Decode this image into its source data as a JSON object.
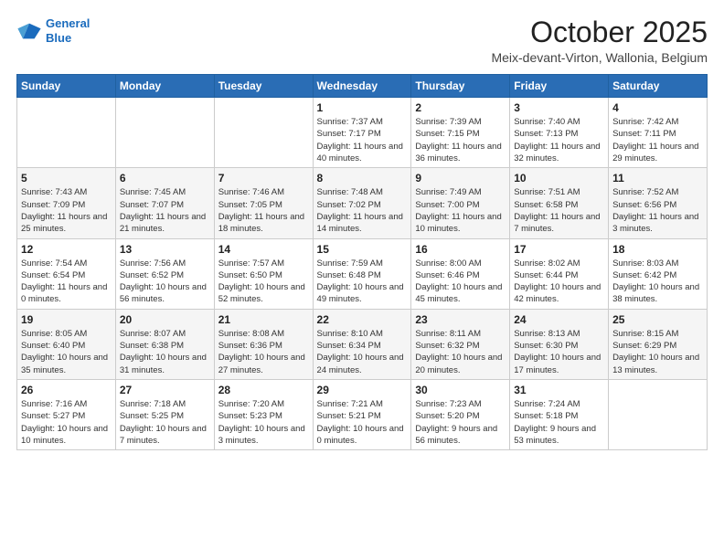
{
  "header": {
    "logo_line1": "General",
    "logo_line2": "Blue",
    "month": "October 2025",
    "location": "Meix-devant-Virton, Wallonia, Belgium"
  },
  "weekdays": [
    "Sunday",
    "Monday",
    "Tuesday",
    "Wednesday",
    "Thursday",
    "Friday",
    "Saturday"
  ],
  "weeks": [
    [
      {
        "day": "",
        "sunrise": "",
        "sunset": "",
        "daylight": ""
      },
      {
        "day": "",
        "sunrise": "",
        "sunset": "",
        "daylight": ""
      },
      {
        "day": "",
        "sunrise": "",
        "sunset": "",
        "daylight": ""
      },
      {
        "day": "1",
        "sunrise": "Sunrise: 7:37 AM",
        "sunset": "Sunset: 7:17 PM",
        "daylight": "Daylight: 11 hours and 40 minutes."
      },
      {
        "day": "2",
        "sunrise": "Sunrise: 7:39 AM",
        "sunset": "Sunset: 7:15 PM",
        "daylight": "Daylight: 11 hours and 36 minutes."
      },
      {
        "day": "3",
        "sunrise": "Sunrise: 7:40 AM",
        "sunset": "Sunset: 7:13 PM",
        "daylight": "Daylight: 11 hours and 32 minutes."
      },
      {
        "day": "4",
        "sunrise": "Sunrise: 7:42 AM",
        "sunset": "Sunset: 7:11 PM",
        "daylight": "Daylight: 11 hours and 29 minutes."
      }
    ],
    [
      {
        "day": "5",
        "sunrise": "Sunrise: 7:43 AM",
        "sunset": "Sunset: 7:09 PM",
        "daylight": "Daylight: 11 hours and 25 minutes."
      },
      {
        "day": "6",
        "sunrise": "Sunrise: 7:45 AM",
        "sunset": "Sunset: 7:07 PM",
        "daylight": "Daylight: 11 hours and 21 minutes."
      },
      {
        "day": "7",
        "sunrise": "Sunrise: 7:46 AM",
        "sunset": "Sunset: 7:05 PM",
        "daylight": "Daylight: 11 hours and 18 minutes."
      },
      {
        "day": "8",
        "sunrise": "Sunrise: 7:48 AM",
        "sunset": "Sunset: 7:02 PM",
        "daylight": "Daylight: 11 hours and 14 minutes."
      },
      {
        "day": "9",
        "sunrise": "Sunrise: 7:49 AM",
        "sunset": "Sunset: 7:00 PM",
        "daylight": "Daylight: 11 hours and 10 minutes."
      },
      {
        "day": "10",
        "sunrise": "Sunrise: 7:51 AM",
        "sunset": "Sunset: 6:58 PM",
        "daylight": "Daylight: 11 hours and 7 minutes."
      },
      {
        "day": "11",
        "sunrise": "Sunrise: 7:52 AM",
        "sunset": "Sunset: 6:56 PM",
        "daylight": "Daylight: 11 hours and 3 minutes."
      }
    ],
    [
      {
        "day": "12",
        "sunrise": "Sunrise: 7:54 AM",
        "sunset": "Sunset: 6:54 PM",
        "daylight": "Daylight: 11 hours and 0 minutes."
      },
      {
        "day": "13",
        "sunrise": "Sunrise: 7:56 AM",
        "sunset": "Sunset: 6:52 PM",
        "daylight": "Daylight: 10 hours and 56 minutes."
      },
      {
        "day": "14",
        "sunrise": "Sunrise: 7:57 AM",
        "sunset": "Sunset: 6:50 PM",
        "daylight": "Daylight: 10 hours and 52 minutes."
      },
      {
        "day": "15",
        "sunrise": "Sunrise: 7:59 AM",
        "sunset": "Sunset: 6:48 PM",
        "daylight": "Daylight: 10 hours and 49 minutes."
      },
      {
        "day": "16",
        "sunrise": "Sunrise: 8:00 AM",
        "sunset": "Sunset: 6:46 PM",
        "daylight": "Daylight: 10 hours and 45 minutes."
      },
      {
        "day": "17",
        "sunrise": "Sunrise: 8:02 AM",
        "sunset": "Sunset: 6:44 PM",
        "daylight": "Daylight: 10 hours and 42 minutes."
      },
      {
        "day": "18",
        "sunrise": "Sunrise: 8:03 AM",
        "sunset": "Sunset: 6:42 PM",
        "daylight": "Daylight: 10 hours and 38 minutes."
      }
    ],
    [
      {
        "day": "19",
        "sunrise": "Sunrise: 8:05 AM",
        "sunset": "Sunset: 6:40 PM",
        "daylight": "Daylight: 10 hours and 35 minutes."
      },
      {
        "day": "20",
        "sunrise": "Sunrise: 8:07 AM",
        "sunset": "Sunset: 6:38 PM",
        "daylight": "Daylight: 10 hours and 31 minutes."
      },
      {
        "day": "21",
        "sunrise": "Sunrise: 8:08 AM",
        "sunset": "Sunset: 6:36 PM",
        "daylight": "Daylight: 10 hours and 27 minutes."
      },
      {
        "day": "22",
        "sunrise": "Sunrise: 8:10 AM",
        "sunset": "Sunset: 6:34 PM",
        "daylight": "Daylight: 10 hours and 24 minutes."
      },
      {
        "day": "23",
        "sunrise": "Sunrise: 8:11 AM",
        "sunset": "Sunset: 6:32 PM",
        "daylight": "Daylight: 10 hours and 20 minutes."
      },
      {
        "day": "24",
        "sunrise": "Sunrise: 8:13 AM",
        "sunset": "Sunset: 6:30 PM",
        "daylight": "Daylight: 10 hours and 17 minutes."
      },
      {
        "day": "25",
        "sunrise": "Sunrise: 8:15 AM",
        "sunset": "Sunset: 6:29 PM",
        "daylight": "Daylight: 10 hours and 13 minutes."
      }
    ],
    [
      {
        "day": "26",
        "sunrise": "Sunrise: 7:16 AM",
        "sunset": "Sunset: 5:27 PM",
        "daylight": "Daylight: 10 hours and 10 minutes."
      },
      {
        "day": "27",
        "sunrise": "Sunrise: 7:18 AM",
        "sunset": "Sunset: 5:25 PM",
        "daylight": "Daylight: 10 hours and 7 minutes."
      },
      {
        "day": "28",
        "sunrise": "Sunrise: 7:20 AM",
        "sunset": "Sunset: 5:23 PM",
        "daylight": "Daylight: 10 hours and 3 minutes."
      },
      {
        "day": "29",
        "sunrise": "Sunrise: 7:21 AM",
        "sunset": "Sunset: 5:21 PM",
        "daylight": "Daylight: 10 hours and 0 minutes."
      },
      {
        "day": "30",
        "sunrise": "Sunrise: 7:23 AM",
        "sunset": "Sunset: 5:20 PM",
        "daylight": "Daylight: 9 hours and 56 minutes."
      },
      {
        "day": "31",
        "sunrise": "Sunrise: 7:24 AM",
        "sunset": "Sunset: 5:18 PM",
        "daylight": "Daylight: 9 hours and 53 minutes."
      },
      {
        "day": "",
        "sunrise": "",
        "sunset": "",
        "daylight": ""
      }
    ]
  ]
}
